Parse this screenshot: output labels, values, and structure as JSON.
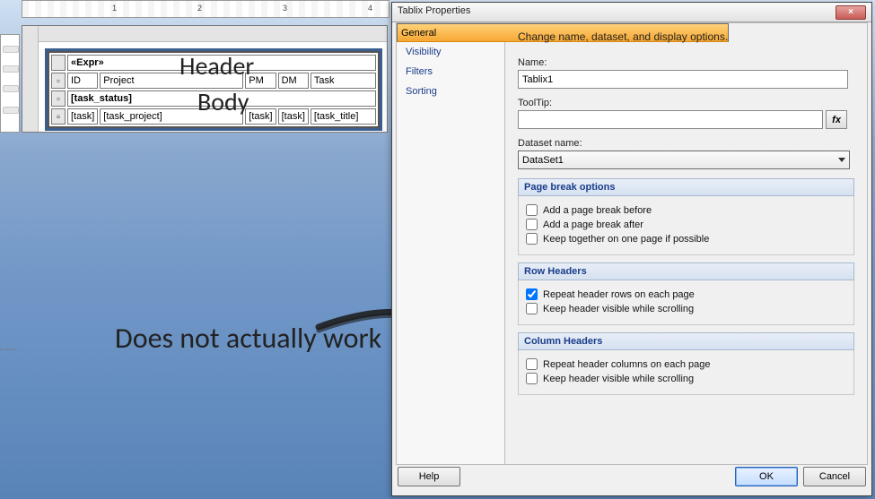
{
  "ruler": {
    "nums": [
      "1",
      "2",
      "3",
      "4"
    ]
  },
  "designer": {
    "expr_cell": "«Expr»",
    "headers": [
      "ID",
      "Project",
      "PM",
      "DM",
      "Task"
    ],
    "row2": "[task_status]",
    "row3": [
      "[task]",
      "[task_project]",
      "[task]",
      "[task]",
      "[task_title]"
    ],
    "annotation_header": "Header",
    "annotation_body": "Body",
    "annotation_main": "Does not actually work"
  },
  "dialog": {
    "title": "Tablix Properties",
    "nav": {
      "general": "General",
      "visibility": "Visibility",
      "filters": "Filters",
      "sorting": "Sorting"
    },
    "subtitle": "Change name, dataset, and display options.",
    "name_label": "Name:",
    "name_value": "Tablix1",
    "tooltip_label": "ToolTip:",
    "dataset_label": "Dataset name:",
    "dataset_value": "DataSet1",
    "pagebreak": {
      "title": "Page break options",
      "before": "Add a page break before",
      "after": "Add a page break after",
      "keep": "Keep together on one page if possible"
    },
    "rowheaders": {
      "title": "Row Headers",
      "repeat": "Repeat header rows on each page",
      "scroll": "Keep header visible while scrolling"
    },
    "colheaders": {
      "title": "Column Headers",
      "repeat": "Repeat header columns on each page",
      "scroll": "Keep header visible while scrolling"
    },
    "buttons": {
      "help": "Help",
      "ok": "OK",
      "cancel": "Cancel"
    },
    "fx": "fx",
    "close": "×"
  }
}
